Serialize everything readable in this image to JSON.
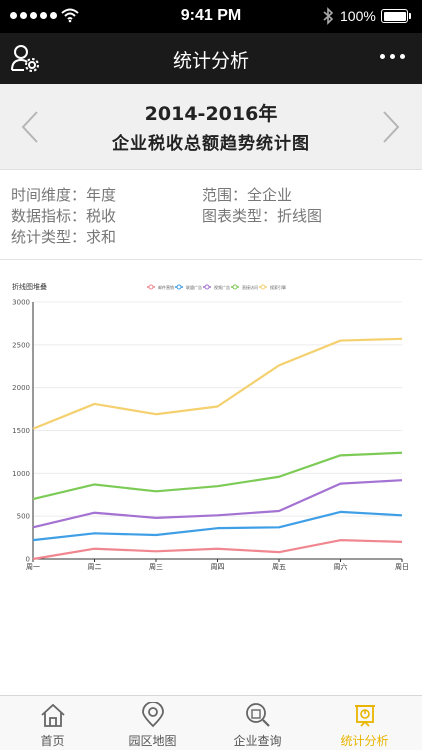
{
  "status_bar": {
    "time": "9:41 PM",
    "battery": "100%"
  },
  "nav": {
    "title": "统计分析"
  },
  "header": {
    "range": "2014-2016年",
    "chart_title": "企业税收总额趋势统计图"
  },
  "info": {
    "time_dimension": "时间维度：年度",
    "scope": "范围：全企业",
    "indicator": "数据指标：税收",
    "chart_type": "图表类型：折线图",
    "stat_type": "统计类型：求和"
  },
  "chart_data": {
    "type": "line",
    "title": "折线图堆叠",
    "categories": [
      "周一",
      "周二",
      "周三",
      "周四",
      "周五",
      "周六",
      "周日"
    ],
    "ylim": [
      0,
      3000
    ],
    "yticks": [
      "0",
      "500",
      "1000",
      "1500",
      "2000",
      "2500",
      "3000"
    ],
    "grid": true,
    "legend_position": "top-center",
    "legend": [
      "邮件营销",
      "联盟广告",
      "视频广告",
      "直接访问",
      "搜索引擎"
    ],
    "series": [
      {
        "name": "邮件营销",
        "color": "#f0868f",
        "values": [
          0,
          120,
          90,
          120,
          80,
          220,
          200
        ]
      },
      {
        "name": "联盟广告",
        "color": "#3f9fe6",
        "values": [
          220,
          300,
          280,
          360,
          370,
          550,
          510
        ]
      },
      {
        "name": "视频广告",
        "color": "#a472d2",
        "values": [
          370,
          540,
          480,
          510,
          560,
          880,
          920
        ]
      },
      {
        "name": "直接访问",
        "color": "#7dcb57",
        "values": [
          700,
          870,
          790,
          850,
          960,
          1210,
          1240
        ]
      },
      {
        "name": "搜索引擎",
        "color": "#f4d06f",
        "values": [
          1520,
          1810,
          1690,
          1780,
          2260,
          2550,
          2570
        ]
      }
    ]
  },
  "tabs": [
    {
      "label": "首页",
      "icon": "home-icon"
    },
    {
      "label": "园区地图",
      "icon": "map-pin-icon"
    },
    {
      "label": "企业查询",
      "icon": "search-building-icon"
    },
    {
      "label": "统计分析",
      "icon": "statistics-icon",
      "active": true
    }
  ],
  "colors": {
    "active_tab": "#e8b400",
    "nav_bg": "#1a1a1a"
  }
}
